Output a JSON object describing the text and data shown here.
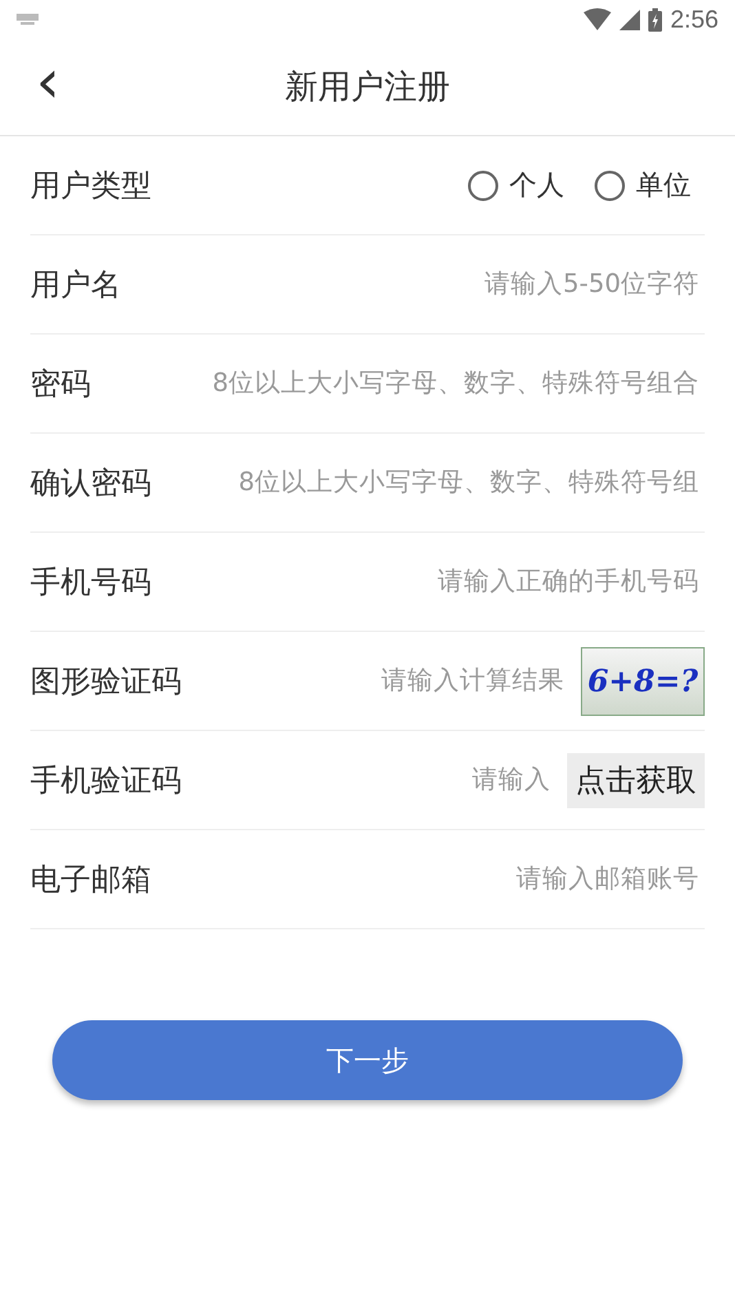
{
  "status_bar": {
    "time": "2:56"
  },
  "header": {
    "back": "‹",
    "title": "新用户注册"
  },
  "form": [
    {
      "kind": "radio",
      "label": "用户类型",
      "options": [
        {
          "label": "个人",
          "selected": false
        },
        {
          "label": "单位",
          "selected": false
        }
      ]
    },
    {
      "kind": "input",
      "label": "用户名",
      "placeholder": "请输入5-50位字符"
    },
    {
      "kind": "input",
      "label": "密码",
      "placeholder": "8位以上大小写字母、数字、特殊符号组合"
    },
    {
      "kind": "input",
      "label": "确认密码",
      "placeholder": "8位以上大小写字母、数字、特殊符号组"
    },
    {
      "kind": "input",
      "label": "手机号码",
      "placeholder": "请输入正确的手机号码"
    },
    {
      "kind": "captcha",
      "label": "图形验证码",
      "placeholder": "请输入计算结果",
      "captcha": "6+8=?"
    },
    {
      "kind": "sms",
      "label": "手机验证码",
      "placeholder": "请输入",
      "button": "点击获取"
    },
    {
      "kind": "input",
      "label": "电子邮箱",
      "placeholder": "请输入邮箱账号"
    }
  ],
  "submit": "下一步"
}
